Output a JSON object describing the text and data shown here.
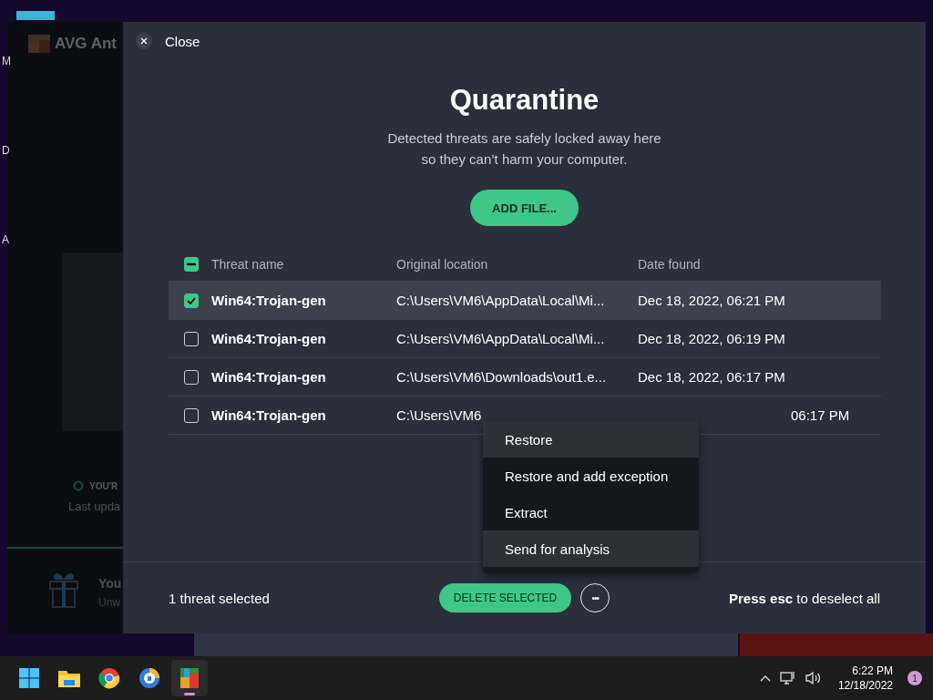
{
  "desktop": {
    "icon_labels": [
      "M",
      "D",
      "A"
    ]
  },
  "background_window": {
    "title": "AVG Ant",
    "status": "YOU'R",
    "update": "Last upda",
    "promo_title": "You",
    "promo_text": "Unw"
  },
  "quarantine": {
    "close_label": "Close",
    "title": "Quarantine",
    "subtitle_lines": [
      "Detected threats are safely locked away here",
      "so they can’t harm your computer."
    ],
    "add_button": "ADD FILE...",
    "table": {
      "select_all": {
        "checked": true,
        "indeterminate": true
      },
      "columns": [
        "Threat name",
        "Original location",
        "Date found"
      ],
      "rows": [
        {
          "selected": true,
          "threat": "Win64:Trojan-gen",
          "location": "C:\\Users\\VM6\\AppData\\Local\\Mi...",
          "date": "Dec 18, 2022, 06:21 PM"
        },
        {
          "selected": false,
          "threat": "Win64:Trojan-gen",
          "location": "C:\\Users\\VM6\\AppData\\Local\\Mi...",
          "date": "Dec 18, 2022, 06:19 PM"
        },
        {
          "selected": false,
          "threat": "Win64:Trojan-gen",
          "location": "C:\\Users\\VM6\\Downloads\\out1.e...",
          "date": "Dec 18, 2022, 06:17 PM"
        },
        {
          "selected": false,
          "threat": "Win64:Trojan-gen",
          "location": "C:\\Users\\VM6",
          "date": "06:17 PM"
        }
      ]
    },
    "context_menu": [
      {
        "label": "Restore",
        "highlighted": true
      },
      {
        "label": "Restore and add exception",
        "highlighted": false
      },
      {
        "label": "Extract",
        "highlighted": false
      },
      {
        "label": "Send for analysis",
        "highlighted": true
      }
    ],
    "footer": {
      "selection_count": "1 threat selected",
      "delete_button": "DELETE SELECTED",
      "more_button": "•••",
      "hint": "**Press esc** to deselect all"
    }
  },
  "taskbar": {
    "apps": [
      {
        "kind": "start",
        "active": false
      },
      {
        "kind": "folder",
        "active": false
      },
      {
        "kind": "browser",
        "active": false
      },
      {
        "kind": "shield",
        "active": false
      },
      {
        "kind": "avg",
        "active": true
      }
    ],
    "time": "6:22 PM",
    "date": "12/18/2022",
    "notification_count": "1"
  }
}
